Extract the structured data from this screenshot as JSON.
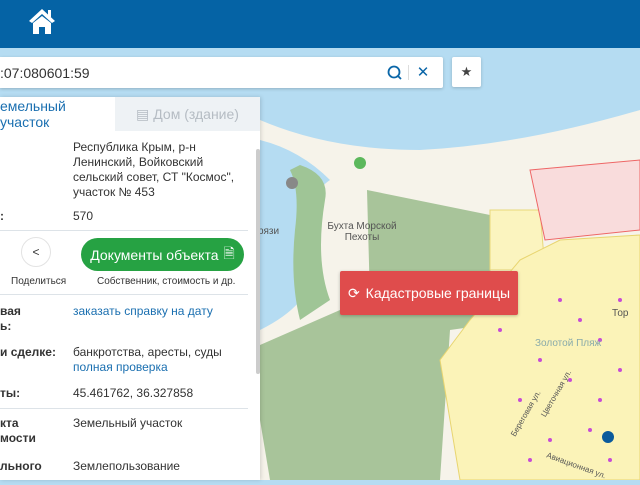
{
  "search": {
    "value": ":07:080601:59"
  },
  "tabs": [
    {
      "label": "емельный участок"
    },
    {
      "label": "Дом (здание)"
    }
  ],
  "info": {
    "address": "Республика Крым, р-н Ленинский, Войковский сельский совет, СТ \"Космос\", участок № 453",
    "area_label": ":",
    "area": "570",
    "share_label": "Поделиться",
    "docs_label": "Документы объекта",
    "docs_sub": "Собственник, стоимость и др.",
    "cadvalue_label_1": "вая",
    "cadvalue_label_2": "ь:",
    "cadvalue_link": "заказать справку на дату",
    "risks_label": "и сделке:",
    "risks_value": "банкротства, аресты, суды",
    "risks_link": "полная проверка",
    "coords_label": "ты:",
    "coords": "45.461762, 36.327858",
    "type_label_1": "кта",
    "type_label_2": "мости",
    "type_value": "Земельный участок",
    "use_label": "льного",
    "use_value": "Землепользование"
  },
  "map": {
    "cadastral_button": "Кадастровые границы",
    "labels": {
      "bay": "Бухта Морской Пехоты",
      "left": "рязи",
      "right_top": "Тор",
      "golden": "Золотой Пляж",
      "street1": "Береговая ул.",
      "street2": "Цветочная ул.",
      "street3": "Авиационная ул."
    }
  }
}
